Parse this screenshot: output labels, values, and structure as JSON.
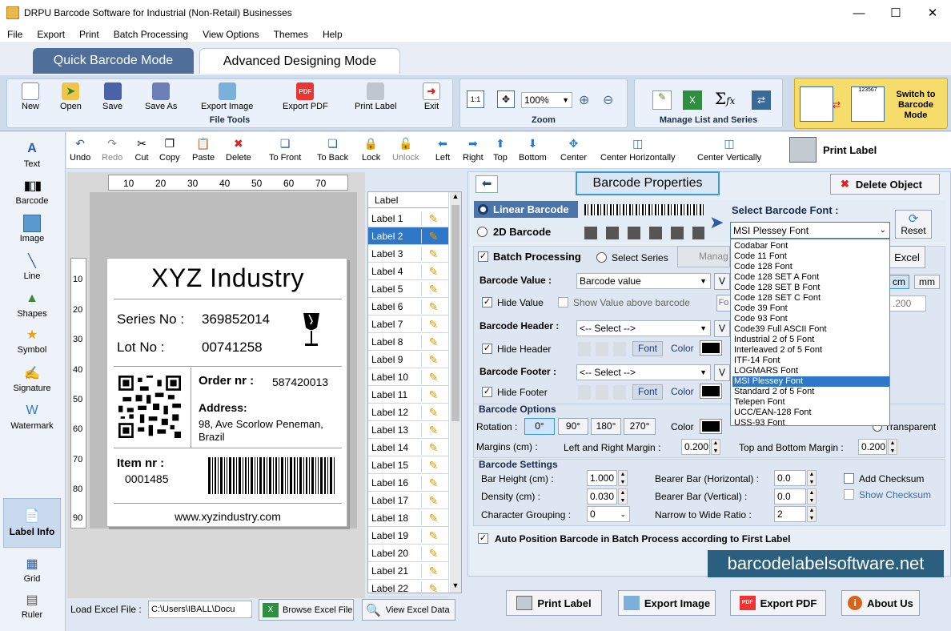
{
  "window": {
    "title": "DRPU Barcode Software for Industrial (Non-Retail) Businesses"
  },
  "menu": [
    "File",
    "Export",
    "Print",
    "Batch Processing",
    "View Options",
    "Themes",
    "Help"
  ],
  "modes": {
    "quick": "Quick Barcode Mode",
    "advanced": "Advanced Designing Mode"
  },
  "ribbon": {
    "file_tools": {
      "title": "File Tools",
      "buttons": [
        "New",
        "Open",
        "Save",
        "Save As",
        "Export Image",
        "Export PDF",
        "Print Label",
        "Exit"
      ]
    },
    "zoom": {
      "title": "Zoom",
      "value": "100%"
    },
    "manage": {
      "title": "Manage List and Series"
    },
    "switch": "Switch to Barcode Mode",
    "switch_number": "123567"
  },
  "left_tools": [
    "Text",
    "Barcode",
    "Image",
    "Line",
    "Shapes",
    "Symbol",
    "Signature",
    "Watermark",
    "Label Info",
    "Grid",
    "Ruler"
  ],
  "edit_tools": [
    "Undo",
    "Redo",
    "Cut",
    "Copy",
    "Paste",
    "Delete",
    "To Front",
    "To Back",
    "Lock",
    "Unlock",
    "Left",
    "Right",
    "Top",
    "Bottom",
    "Center",
    "Center Horizontally",
    "Center Vertically"
  ],
  "print_label": "Print Label",
  "ruler": {
    "h": [
      "10",
      "20",
      "30",
      "40",
      "50",
      "60",
      "70"
    ],
    "v": [
      "10",
      "20",
      "30",
      "40",
      "50",
      "60",
      "70",
      "80",
      "90"
    ]
  },
  "label": {
    "company": "XYZ Industry",
    "series_label": "Series No :",
    "series_value": "369852014",
    "lot_label": "Lot No :",
    "lot_value": "00741258",
    "order_label": "Order nr :",
    "order_value": "587420013",
    "address_label": "Address:",
    "address_line1": "98, Ave Scorlow Peneman,",
    "address_line2": "Brazil",
    "item_label": "Item nr :",
    "item_value": "0001485",
    "website": "www.xyzindustry.com"
  },
  "label_list": {
    "header": "Label",
    "selected": 1,
    "items": [
      "Label 1",
      "Label 2",
      "Label 3",
      "Label 4",
      "Label 5",
      "Label 6",
      "Label 7",
      "Label 8",
      "Label 9",
      "Label 10",
      "Label 11",
      "Label 12",
      "Label 13",
      "Label 14",
      "Label 15",
      "Label 16",
      "Label 17",
      "Label 18",
      "Label 19",
      "Label 20",
      "Label 21",
      "Label 22"
    ]
  },
  "excel": {
    "load_label": "Load Excel File :",
    "path": "C:\\Users\\IBALL\\Docu",
    "browse": "Browse Excel File",
    "view": "View Excel Data"
  },
  "properties": {
    "title": "Barcode Properties",
    "delete": "Delete Object",
    "linear": "Linear Barcode",
    "twod": "2D Barcode",
    "select_font_label": "Select Barcode Font :",
    "selected_font": "MSI Plessey Font",
    "reset": "Reset",
    "batch": "Batch Processing",
    "select_series": "Select Series",
    "manage": "Manag",
    "excel": "Excel",
    "value_label": "Barcode Value :",
    "value_select": "Barcode value",
    "hide_value": "Hide Value",
    "show_above": "Show Value above barcode",
    "header_label": "Barcode Header :",
    "select_placeholder": "<-- Select -->",
    "hide_header": "Hide Header",
    "footer_label": "Barcode Footer :",
    "hide_footer": "Hide Footer",
    "font_btn": "Font",
    "color": "Color",
    "options_title": "Barcode Options",
    "rotation": "Rotation :",
    "rotations": [
      "0°",
      "90°",
      "180°",
      "270°"
    ],
    "background": "Background",
    "color_opt": "Color",
    "transparent": "Transparent",
    "margins_label": "Margins (cm) :",
    "lr_margin": "Left and Right Margin :",
    "lr_value": "0.200",
    "tb_margin": "Top and Bottom Margin :",
    "tb_value": "0.200",
    "units": [
      "cm",
      "mm"
    ],
    "partial_value": ".200",
    "fo": "Fo",
    "v": "V",
    "settings_title": "Barcode Settings",
    "bar_height": "Bar Height (cm) :",
    "bar_height_value": "1.000",
    "density": "Density (cm) :",
    "density_value": "0.030",
    "char_group": "Character Grouping :",
    "char_group_value": "0",
    "bearer_h": "Bearer Bar (Horizontal) :",
    "bearer_h_value": "0.0",
    "bearer_v": "Bearer Bar (Vertical) :",
    "bearer_v_value": "0.0",
    "narrow_wide": "Narrow to Wide Ratio :",
    "narrow_wide_value": "2",
    "add_checksum": "Add Checksum",
    "show_checksum": "Show Checksum",
    "auto_position": "Auto Position Barcode in Batch Process according to First Label"
  },
  "font_dropdown": [
    "Codabar Font",
    "Code 11 Font",
    "Code 128 Font",
    "Code 128 SET A Font",
    "Code 128 SET B Font",
    "Code 128 SET C Font",
    "Code 39 Font",
    "Code 93 Font",
    "Code39 Full ASCII Font",
    "Industrial 2 of 5 Font",
    "Interleaved 2 of 5 Font",
    "ITF-14 Font",
    "LOGMARS Font",
    "MSI Plessey Font",
    "Standard 2 of 5 Font",
    "Telepen Font",
    "UCC/EAN-128 Font",
    "USS-93 Font"
  ],
  "font_dropdown_selected": 13,
  "brand": "barcodelabelsoftware.net",
  "bottom_buttons": [
    "Print Label",
    "Export Image",
    "Export PDF",
    "About Us"
  ]
}
